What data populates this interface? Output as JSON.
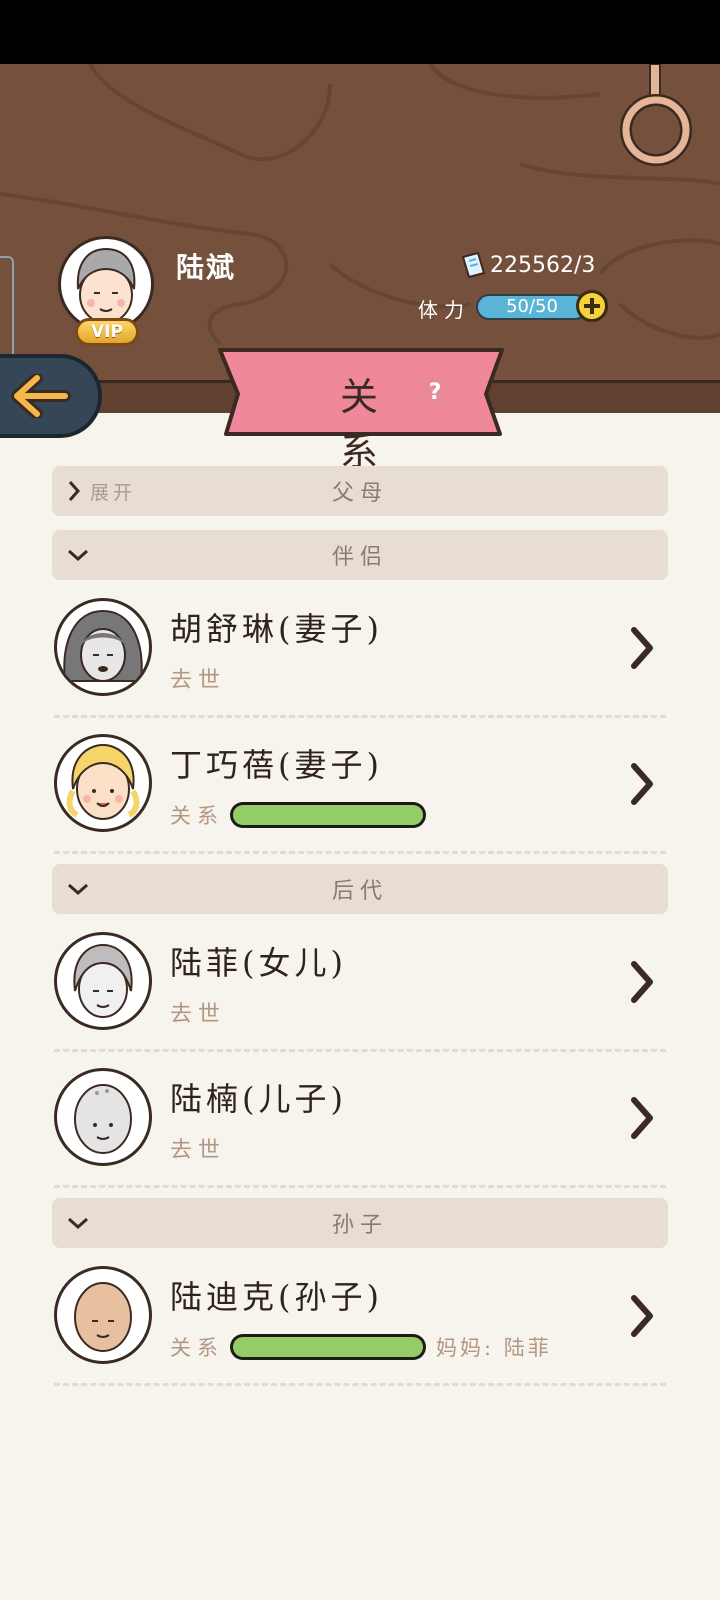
{
  "player": {
    "name": "陆斌",
    "vip_label": "VIP",
    "money": "225562/3",
    "energy_label": "体力",
    "energy_value": "50/50"
  },
  "title": {
    "text": "关系",
    "help": "?"
  },
  "sections": {
    "parents": {
      "expand_label": "展开",
      "title": "父母"
    },
    "partners": {
      "title": "伴侣"
    },
    "descendants": {
      "title": "后代"
    },
    "grandchildren": {
      "title": "孙子"
    }
  },
  "members": [
    {
      "name": "胡舒琳(妻子)",
      "status": "去世"
    },
    {
      "name": "丁巧蓓(妻子)",
      "rel_label": "关系",
      "relation_level": 1.0
    },
    {
      "name": "陆菲(女儿)",
      "status": "去世"
    },
    {
      "name": "陆楠(儿子)",
      "status": "去世"
    },
    {
      "name": "陆迪克(孙子)",
      "rel_label": "关系",
      "relation_level": 1.0,
      "extra": "妈妈: 陆菲"
    }
  ],
  "colors": {
    "header_bg": "#74503d",
    "ribbon": "#f0889b",
    "relation_fill": "#94cd68",
    "energy_bar": "#5ab4d6",
    "section_bg": "#e8ddd2"
  }
}
